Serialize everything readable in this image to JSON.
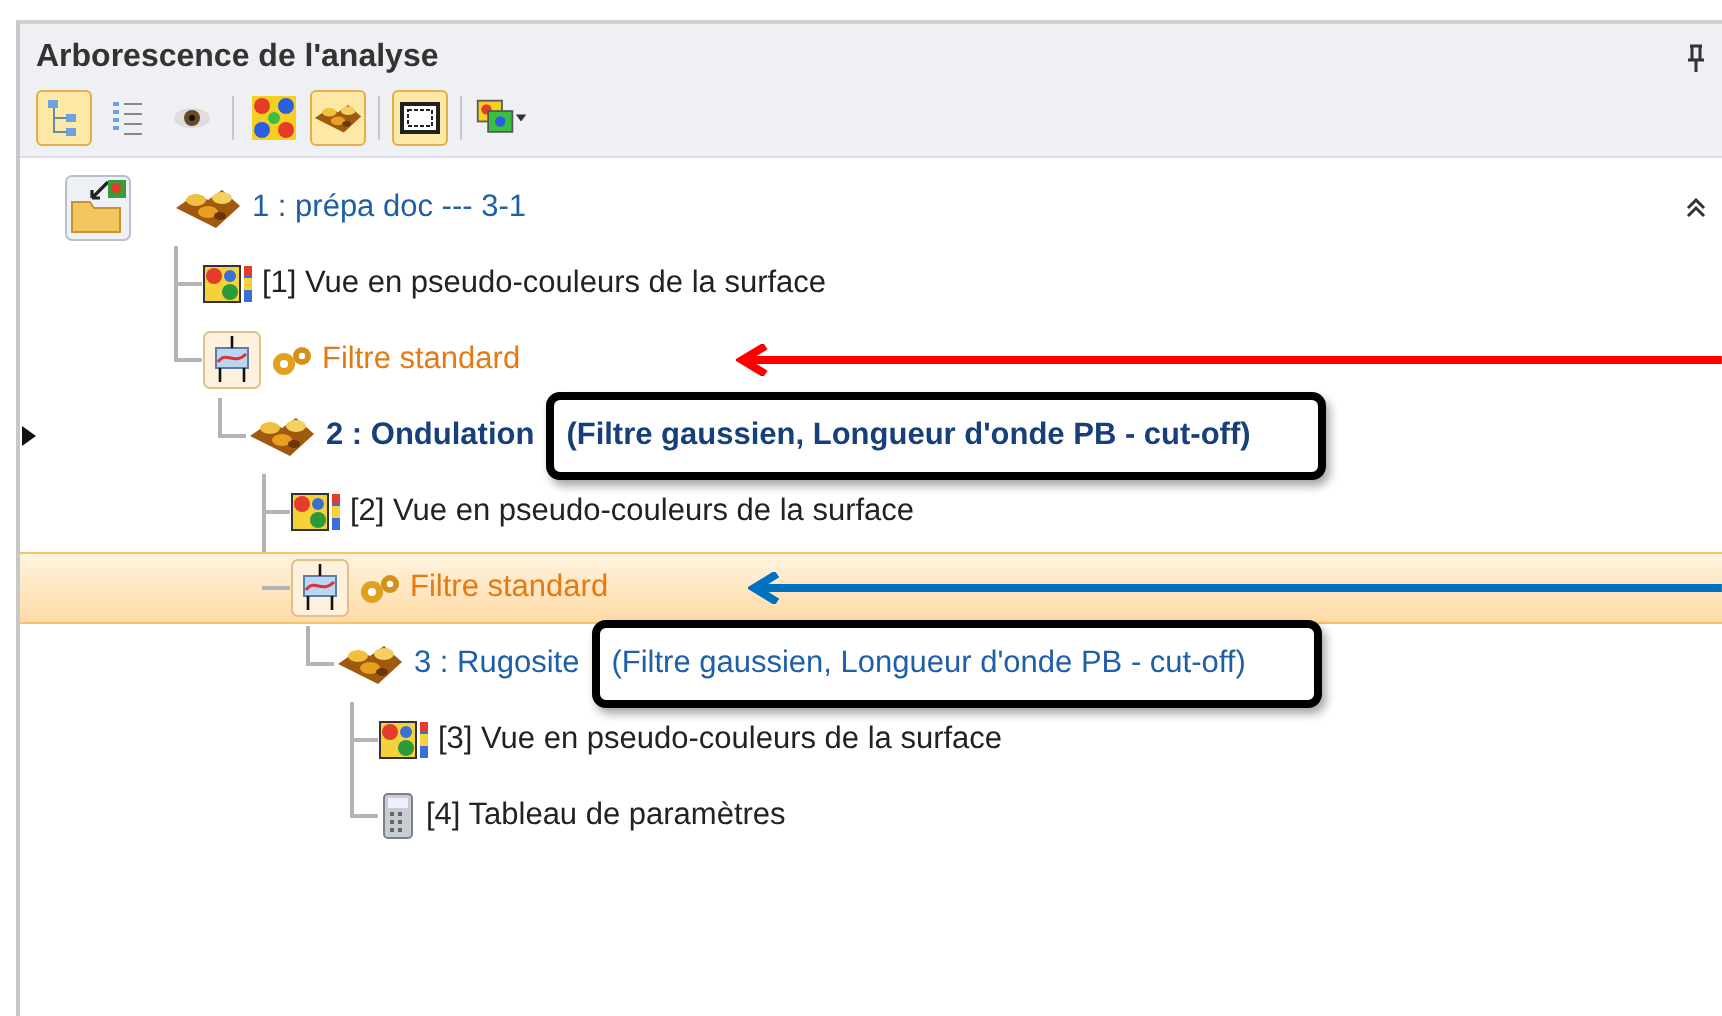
{
  "panel": {
    "title": "Arborescence de l'analyse"
  },
  "toolbar": [
    {
      "kind": "tree",
      "selected": true
    },
    {
      "kind": "list",
      "selected": false
    },
    {
      "kind": "eye",
      "selected": false
    },
    {
      "kind": "colormap",
      "selected": false
    },
    {
      "kind": "surface",
      "selected": true
    },
    {
      "kind": "frame",
      "selected": true
    },
    {
      "kind": "multi",
      "selected": false
    }
  ],
  "tree": {
    "kind": "project",
    "label": "1 : prépa doc --- 3-1",
    "selected": false,
    "children": [
      {
        "kind": "view",
        "label": "[1] Vue en pseudo-couleurs de la surface",
        "selected": false
      },
      {
        "kind": "filter",
        "label": "Filtre standard",
        "selected": false,
        "arrow": {
          "color": "#ff0000"
        },
        "children": [
          {
            "kind": "surface",
            "label": "2 : Ondulation",
            "detail": "(Filtre gaussien, Longueur d'onde PB - cut-off)",
            "bold": true,
            "pointer": true,
            "selected": false,
            "children": [
              {
                "kind": "view",
                "label": "[2] Vue en pseudo-couleurs de la surface",
                "selected": false
              },
              {
                "kind": "filter",
                "label": "Filtre standard",
                "selected": true,
                "arrow": {
                  "color": "#0070c0"
                },
                "children": [
                  {
                    "kind": "surface",
                    "label": "3 : Rugosite",
                    "detail": "(Filtre gaussien, Longueur d'onde PB - cut-off)",
                    "bold": false,
                    "pointer": false,
                    "selected": false,
                    "children": [
                      {
                        "kind": "view",
                        "label": "[3] Vue en pseudo-couleurs de la surface",
                        "selected": false
                      },
                      {
                        "kind": "table",
                        "label": "[4] Tableau de paramètres",
                        "selected": false
                      }
                    ]
                  }
                ]
              }
            ]
          }
        ]
      }
    ]
  }
}
